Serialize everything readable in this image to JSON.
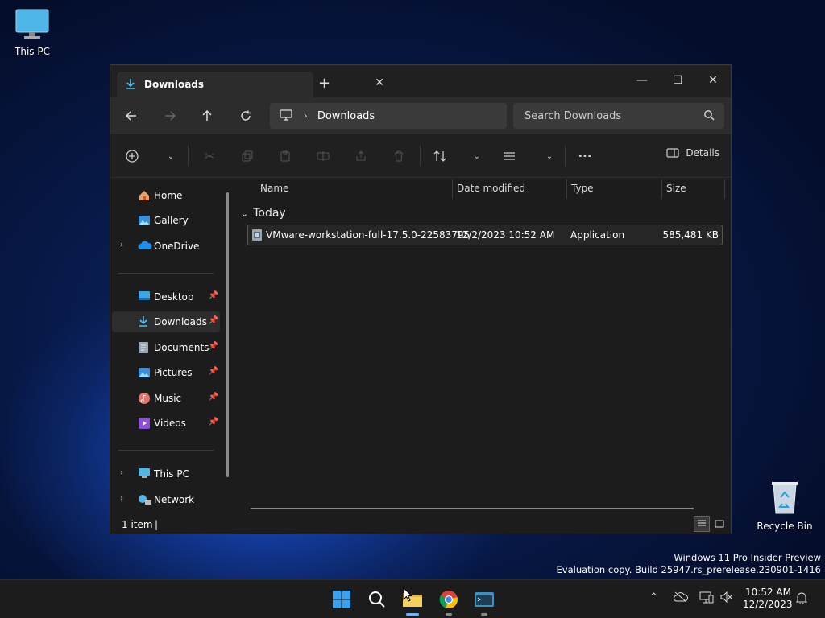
{
  "desktop": {
    "this_pc_label": "This PC",
    "recycle_bin_label": "Recycle Bin",
    "watermark_line1": "Windows 11 Pro Insider Preview",
    "watermark_line2": "Evaluation copy. Build 25947.rs_prerelease.230901-1416"
  },
  "window": {
    "tab_title": "Downloads",
    "address_path": "Downloads",
    "search_placeholder": "Search Downloads",
    "details_label": "Details"
  },
  "sidebar": {
    "items": [
      {
        "label": "Home"
      },
      {
        "label": "Gallery"
      },
      {
        "label": "OneDrive"
      },
      {
        "label": "Desktop"
      },
      {
        "label": "Downloads"
      },
      {
        "label": "Documents"
      },
      {
        "label": "Pictures"
      },
      {
        "label": "Music"
      },
      {
        "label": "Videos"
      },
      {
        "label": "This PC"
      },
      {
        "label": "Network"
      }
    ]
  },
  "columns": {
    "name": "Name",
    "date": "Date modified",
    "type": "Type",
    "size": "Size"
  },
  "group": {
    "label": "Today"
  },
  "files": [
    {
      "name": "VMware-workstation-full-17.5.0-22583795",
      "date": "12/2/2023 10:52 AM",
      "type": "Application",
      "size": "585,481 KB"
    }
  ],
  "status": {
    "count": "1 item",
    "bar": "|"
  },
  "taskbar": {
    "time": "10:52 AM",
    "date": "12/2/2023"
  },
  "colors": {
    "accent": "#4cc2ff",
    "window_bg": "#1c1c1c"
  }
}
